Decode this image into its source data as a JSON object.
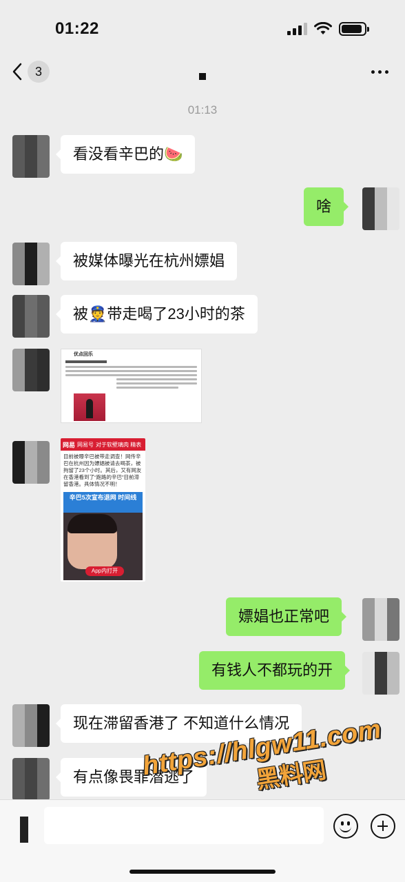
{
  "status_bar": {
    "time": "01:22",
    "battery_level": 0.9
  },
  "nav": {
    "unread_count": "3",
    "title": ""
  },
  "timestamp": "01:13",
  "messages": [
    {
      "side": "left",
      "type": "text",
      "text": "看没看辛巴的🍉"
    },
    {
      "side": "right",
      "type": "text",
      "text": "啥"
    },
    {
      "side": "left",
      "type": "text",
      "text": "被媒体曝光在杭州嫖娼"
    },
    {
      "side": "left",
      "type": "text",
      "text": "被👮带走喝了23小时的茶"
    },
    {
      "side": "left",
      "type": "image",
      "title": "优点回乐"
    },
    {
      "side": "left",
      "type": "image",
      "header_tabs": [
        "网易",
        "网易号",
        "对于软壁璃肉 精表"
      ],
      "body": "目前被曝辛巴被带走调查！网传辛巴在杭州因为嫖娼被请去喝茶，被拘留了23个小时。其后，又有网友在香港看到了“跑路的辛巴”目前滞留香港。具体情况不明！",
      "banner": "辛巴5次宣布退网 时间线",
      "open_button": "App内打开"
    },
    {
      "side": "right",
      "type": "text",
      "text": "嫖娼也正常吧"
    },
    {
      "side": "right",
      "type": "text",
      "text": "有钱人不都玩的开"
    },
    {
      "side": "left",
      "type": "text",
      "text": "现在滞留香港了 不知道什么情况"
    },
    {
      "side": "left",
      "type": "text",
      "text": "有点像畏罪潜逃了"
    }
  ],
  "watermark": {
    "url": "https://hlgw11.com",
    "name": "黑料网"
  },
  "input": {
    "value": "",
    "placeholder": ""
  },
  "colors": {
    "background": "#ededed",
    "bubble_left": "#ffffff",
    "bubble_right": "#95ec69",
    "watermark": "#f2a43a"
  }
}
